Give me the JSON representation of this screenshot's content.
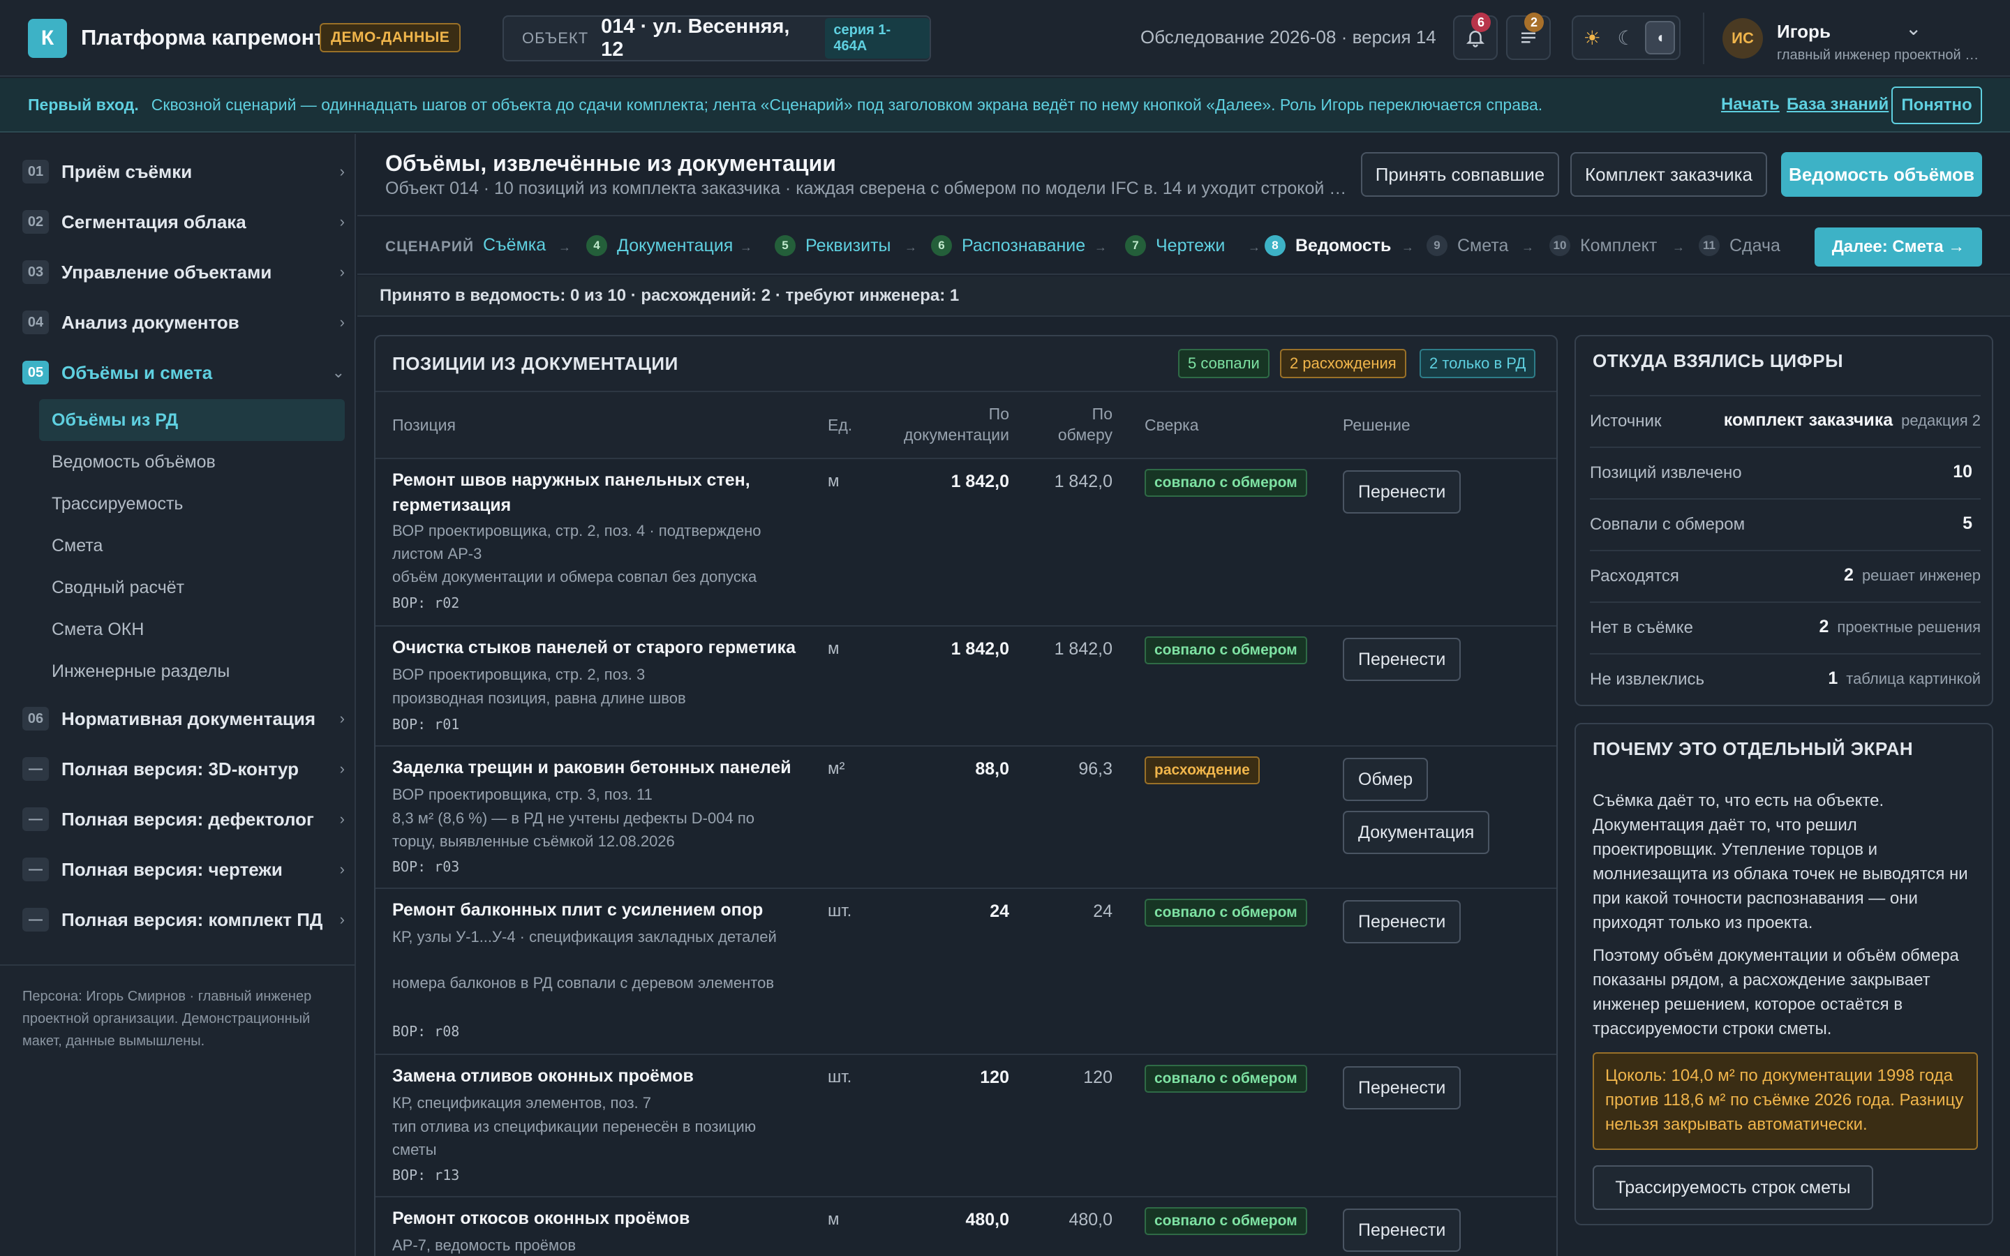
{
  "topbar": {
    "logo_letter": "К",
    "app_title": "Платформа капремонта",
    "demo_badge": "ДЕМО-ДАННЫЕ",
    "object_label": "ОБЪЕКТ",
    "object_value": "014 · ул. Весенняя, 12",
    "series_badge": "серия 1-464А",
    "survey_info": "Обследование 2026-08 · версия 14",
    "notifications_count": "6",
    "tasks_count": "2",
    "user_initials": "ИС",
    "user_name": "Игорь",
    "user_role": "главный инженер проектной ор..."
  },
  "banner": {
    "title": "Первый вход.",
    "text": "Сквозной сценарий — одиннадцать шагов от объекта до сдачи комплекта; лента «Сценарий» под заголовком экрана ведёт по нему кнопкой «Далее». Роль Игорь переключается справа.",
    "start_link": "Начать",
    "kb_link": "База знаний",
    "ok_button": "Понятно"
  },
  "sidebar": {
    "items": [
      {
        "num": "01",
        "label": "Приём съёмки"
      },
      {
        "num": "02",
        "label": "Сегментация облака"
      },
      {
        "num": "03",
        "label": "Управление объектами"
      },
      {
        "num": "04",
        "label": "Анализ документов"
      },
      {
        "num": "05",
        "label": "Объёмы и смета"
      },
      {
        "num": "06",
        "label": "Нормативная документация"
      },
      {
        "num": "—",
        "label": "Полная версия: 3D-контур"
      },
      {
        "num": "—",
        "label": "Полная версия: дефектолог"
      },
      {
        "num": "—",
        "label": "Полная версия: чертежи"
      },
      {
        "num": "—",
        "label": "Полная версия: комплект ПД"
      }
    ],
    "subitems": [
      "Объёмы из РД",
      "Ведомость объёмов",
      "Трассируемость",
      "Смета",
      "Сводный расчёт",
      "Смета ОКН",
      "Инженерные разделы"
    ],
    "note": "Персона: Игорь Смирнов · главный инженер проектной организации. Демонстрационный макет, данные вымышлены."
  },
  "header": {
    "title": "Объёмы, извлечённые из документации",
    "subtitle": "Объект 014 · 10 позиций из комплекта заказчика · каждая сверена с обмером по модели IFC в. 14 и уходит строкой в ...",
    "btn_accept": "Принять совпавшие",
    "btn_kit": "Комплект заказчика",
    "btn_vedomost": "Ведомость объёмов"
  },
  "stepper": {
    "label": "СЦЕНАРИЙ",
    "steps": [
      {
        "num": "",
        "label": "Съёмка"
      },
      {
        "num": "4",
        "label": "Документация"
      },
      {
        "num": "5",
        "label": "Реквизиты"
      },
      {
        "num": "6",
        "label": "Распознавание"
      },
      {
        "num": "7",
        "label": "Чертежи"
      },
      {
        "num": "8",
        "label": "Ведомость"
      },
      {
        "num": "9",
        "label": "Смета"
      },
      {
        "num": "10",
        "label": "Комплект"
      },
      {
        "num": "11",
        "label": "Сдача"
      }
    ],
    "next_button": "Далее: Смета →"
  },
  "summary": "Принято в ведомость: 0 из 10 · расхождений: 2 · требуют инженера: 1",
  "table": {
    "title": "ПОЗИЦИИ ИЗ ДОКУМЕНТАЦИИ",
    "chips": [
      "5 совпали",
      "2 расхождения",
      "2 только в РД"
    ],
    "headers": {
      "position": "Позиция",
      "unit": "Ед.",
      "doc_1": "По",
      "doc_2": "документации",
      "meas_1": "По",
      "meas_2": "обмеру",
      "check": "Сверка",
      "decision": "Решение"
    },
    "rows": [
      {
        "title": "Ремонт швов наружных панельных стен, герметизация",
        "source": "ВОР проектировщика, стр. 2, поз. 4 · подтверждено листом АР-3",
        "note": "объём документации и обмера совпал без допуска",
        "code": "ВОР: r02",
        "unit": "м",
        "doc": "1 842,0",
        "meas": "1 842,0",
        "status": "совпало с обмером",
        "actions": [
          "Перенести"
        ]
      },
      {
        "title": "Очистка стыков панелей от старого герметика",
        "source": "ВОР проектировщика, стр. 2, поз. 3",
        "note": "производная позиция, равна длине швов",
        "code": "ВОР: r01",
        "unit": "м",
        "doc": "1 842,0",
        "meas": "1 842,0",
        "status": "совпало с обмером",
        "actions": [
          "Перенести"
        ]
      },
      {
        "title": "Заделка трещин и раковин бетонных панелей",
        "source": "ВОР проектировщика, стр. 3, поз. 11",
        "note": "8,3 м² (8,6 %) — в РД не учтены дефекты D-004 по торцу, выявленные съёмкой 12.08.2026",
        "code": "ВОР: r03",
        "unit": "м²",
        "doc": "88,0",
        "meas": "96,3",
        "status": "расхождение",
        "actions": [
          "Обмер",
          "Документация"
        ]
      },
      {
        "title": "Ремонт балконных плит с усилением опор",
        "source": "КР, узлы У-1...У-4 · спецификация закладных деталей",
        "note": "номера балконов в РД совпали с деревом элементов",
        "code": "ВОР: r08",
        "unit": "шт.",
        "doc": "24",
        "meas": "24",
        "status": "совпало с обмером",
        "actions": [
          "Перенести"
        ]
      },
      {
        "title": "Замена отливов оконных проёмов",
        "source": "КР, спецификация элементов, поз. 7",
        "note": "тип отлива из спецификации перенесён в позицию сметы",
        "code": "ВОР: r13",
        "unit": "шт.",
        "doc": "120",
        "meas": "120",
        "status": "совпало с обмером",
        "actions": [
          "Перенести"
        ]
      },
      {
        "title": "Ремонт откосов оконных проёмов",
        "source": "АР-7, ведомость проёмов",
        "note": "",
        "code": "",
        "unit": "м",
        "doc": "480,0",
        "meas": "480,0",
        "status": "совпало с обмером",
        "actions": [
          "Перенести"
        ]
      }
    ]
  },
  "sources_panel": {
    "title": "ОТКУДА ВЗЯЛИСЬ ЦИФРЫ",
    "rows": [
      {
        "key": "Источник",
        "value": "комплект заказчика",
        "note": "редакция 2"
      },
      {
        "key": "Позиций извлечено",
        "value": "10",
        "note": ""
      },
      {
        "key": "Совпали с обмером",
        "value": "5",
        "note": ""
      },
      {
        "key": "Расходятся",
        "value": "2",
        "note": "решает инженер"
      },
      {
        "key": "Нет в съёмке",
        "value": "2",
        "note": "проектные решения"
      },
      {
        "key": "Не извлеклись",
        "value": "1",
        "note": "таблица картинкой"
      }
    ]
  },
  "why_panel": {
    "title": "ПОЧЕМУ ЭТО ОТДЕЛЬНЫЙ ЭКРАН",
    "p1": "Съёмка даёт то, что есть на объекте. Документация даёт то, что решил проектировщик. Утепление торцов и молниезащита из облака точек не выводятся ни при какой точности распознавания — они приходят только из проекта.",
    "p2": "Поэтому объём документации и объём обмера показаны рядом, а расхождение закрывает инженер решением, которое остаётся в трассируемости строки сметы.",
    "warning": "Цоколь: 104,0 м² по документации 1998 года против 118,6 м² по съёмке 2026 года. Разницу нельзя закрывать автоматически.",
    "trace_button": "Трассируемость строк сметы"
  },
  "colors": {
    "accent": "#3db2c6",
    "ok": "#7ee2a3",
    "warn": "#f0b54b",
    "badge_red": "#b8344a",
    "badge_amber": "#a8702a"
  }
}
